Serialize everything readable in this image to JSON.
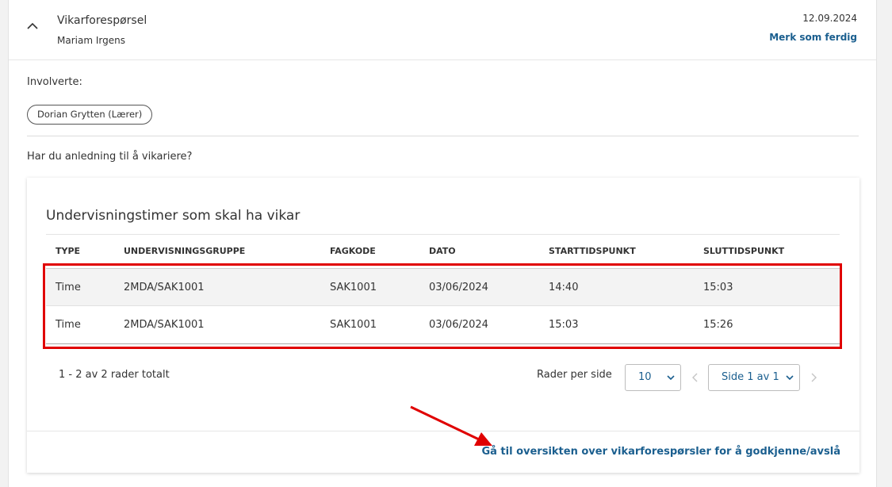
{
  "header": {
    "title": "Vikarforespørsel",
    "subtitle": "Mariam Irgens",
    "date": "12.09.2024",
    "mark_done": "Merk som ferdig"
  },
  "involved": {
    "label": "Involverte:",
    "chips": [
      "Dorian Grytten (Lærer)"
    ]
  },
  "question": "Har du anledning til å vikariere?",
  "table": {
    "title": "Undervisningstimer som skal ha vikar",
    "columns": [
      "TYPE",
      "UNDERVISNINGSGRUPPE",
      "FAGKODE",
      "DATO",
      "STARTTIDSPUNKT",
      "SLUTTIDSPUNKT"
    ],
    "rows": [
      [
        "Time",
        "2MDA/SAK1001",
        "SAK1001",
        "03/06/2024",
        "14:40",
        "15:03"
      ],
      [
        "Time",
        "2MDA/SAK1001",
        "SAK1001",
        "03/06/2024",
        "15:03",
        "15:26"
      ]
    ]
  },
  "pagination": {
    "total": "1 - 2 av 2 rader totalt",
    "rows_per_page_label": "Rader per side",
    "rows_per_page": "10",
    "page": "Side 1 av 1"
  },
  "footer": {
    "link": "Gå til oversikten over vikarforespørsler for å godkjenne/avslå"
  },
  "colors": {
    "accent": "#1b5f8f",
    "highlight": "#e00000"
  }
}
